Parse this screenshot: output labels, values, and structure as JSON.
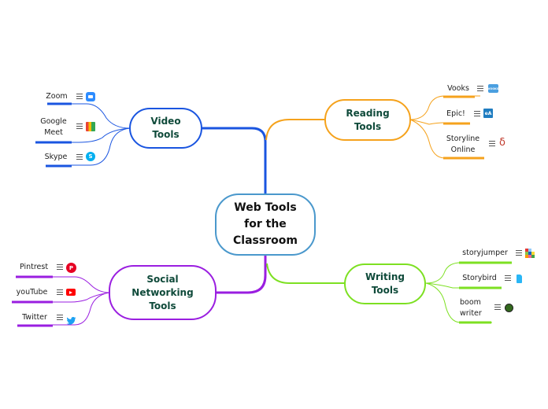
{
  "colors": {
    "central": "#4a98cc",
    "video": "#1a55e0",
    "reading": "#f5a21c",
    "writing": "#7de022",
    "social": "#9a1ee0",
    "text_dark_green": "#0f4a3a"
  },
  "central": {
    "label": "Web Tools\nfor the\nClassroom"
  },
  "branches": {
    "video": {
      "label": "Video\nTools",
      "children": [
        {
          "label": "Zoom",
          "icon": "zoom-icon"
        },
        {
          "label": "Google\nMeet",
          "icon": "google-meet-icon"
        },
        {
          "label": "Skype",
          "icon": "skype-icon"
        }
      ]
    },
    "reading": {
      "label": "Reading\nTools",
      "children": [
        {
          "label": "Vooks",
          "icon": "vooks-icon"
        },
        {
          "label": "Epic!",
          "icon": "epic-icon"
        },
        {
          "label": "Storyline\nOnline",
          "icon": "storyline-online-icon"
        }
      ]
    },
    "writing": {
      "label": "Writing\nTools",
      "children": [
        {
          "label": "storyjumper",
          "icon": "storyjumper-icon"
        },
        {
          "label": "Storybird",
          "icon": "storybird-icon"
        },
        {
          "label": "boom\nwriter",
          "icon": "boomwriter-icon"
        }
      ]
    },
    "social": {
      "label": "Social\nNetworking\nTools",
      "children": [
        {
          "label": "Pintrest",
          "icon": "pinterest-icon"
        },
        {
          "label": "youTube",
          "icon": "youtube-icon"
        },
        {
          "label": "Twitter",
          "icon": "twitter-icon"
        }
      ]
    }
  },
  "icon_text": {
    "vooks": "VOOKS",
    "epic": "eA",
    "skype": "S",
    "storyline": "δ",
    "pinterest": "P"
  }
}
